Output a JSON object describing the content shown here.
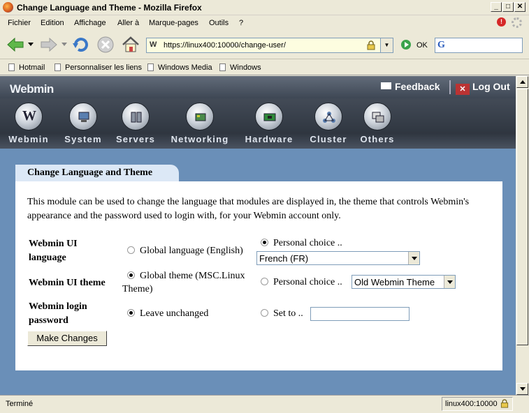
{
  "window": {
    "title": "Change Language and Theme - Mozilla Firefox"
  },
  "menu": [
    "Fichier",
    "Edition",
    "Affichage",
    "Aller à",
    "Marque-pages",
    "Outils",
    "?"
  ],
  "nav": {
    "url": "https://linux400:10000/change-user/",
    "go_label": "OK"
  },
  "bookmarks": [
    "Hotmail",
    "Personnaliser les liens",
    "Windows Media",
    "Windows"
  ],
  "webmin": {
    "logo": "Webmin",
    "feedback": "Feedback",
    "logout": "Log Out",
    "categories": [
      "Webmin",
      "System",
      "Servers",
      "Networking",
      "Hardware",
      "Cluster",
      "Others"
    ]
  },
  "page": {
    "tab_title": "Change Language and Theme",
    "intro": "This module can be used to change the language that modules are displayed in, the theme that controls Webmin's appearance and the password used to login with, for your Webmin account only.",
    "language": {
      "label": "Webmin UI language",
      "global": "Global language (English)",
      "personal": "Personal choice ..",
      "selected": "French (FR)"
    },
    "theme": {
      "label": "Webmin UI theme",
      "global": "Global theme (MSC.Linux Theme)",
      "personal": "Personal choice ..",
      "selected": "Old Webmin Theme"
    },
    "password": {
      "label": "Webmin login password",
      "leave": "Leave unchanged",
      "set": "Set to ..",
      "value": ""
    },
    "submit": "Make Changes"
  },
  "status": {
    "text": "Terminé",
    "host": "linux400:10000"
  }
}
